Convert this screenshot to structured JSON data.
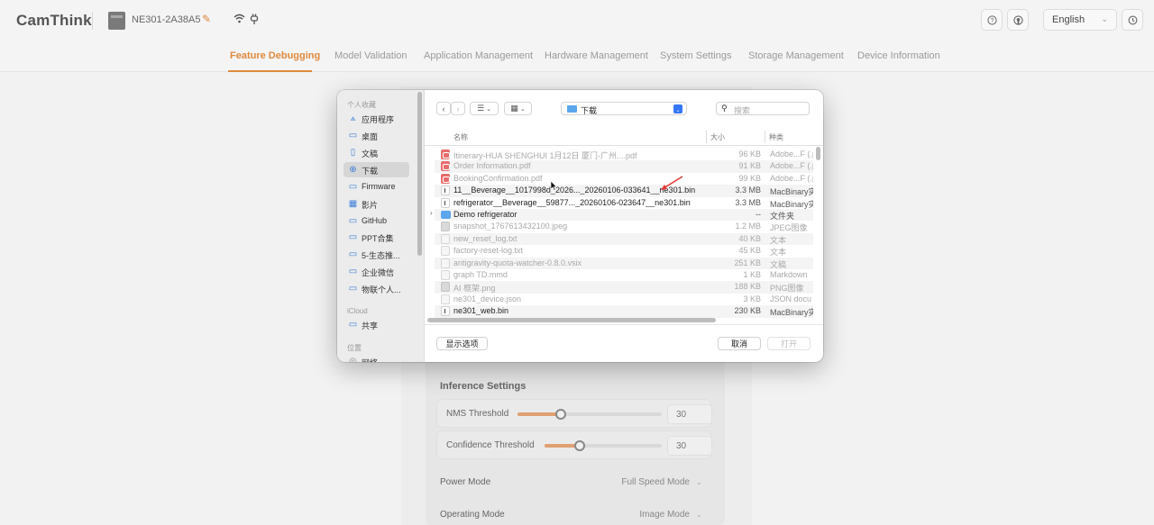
{
  "app": {
    "logo": "CamThink",
    "device_name": "NE301-2A38A5",
    "language": "English"
  },
  "nav": {
    "tabs": [
      {
        "label": "Feature Debugging"
      },
      {
        "label": "Model Validation"
      },
      {
        "label": "Application Management"
      },
      {
        "label": "Hardware Management"
      },
      {
        "label": "System Settings"
      },
      {
        "label": "Storage Management"
      },
      {
        "label": "Device Information"
      }
    ],
    "active_tab": "Feature Debugging"
  },
  "settings": {
    "inference_title": "Inference Settings",
    "nms": {
      "label": "NMS Threshold",
      "value": "30",
      "level": 0.3
    },
    "confidence": {
      "label": "Confidence Threshold",
      "value": "30",
      "level": 0.3
    },
    "power_mode": {
      "label": "Power Mode",
      "value": "Full Speed Mode"
    },
    "operating_mode": {
      "label": "Operating Mode",
      "value": "Image Mode"
    }
  },
  "dialog": {
    "location": "下载",
    "search_placeholder": "搜索",
    "columns": {
      "name": "名称",
      "size": "大小",
      "kind": "种类"
    },
    "sidebar": {
      "favorites_title": "个人收藏",
      "favorites": [
        {
          "label": "应用程序",
          "icon": "apps-icon"
        },
        {
          "label": "桌面",
          "icon": "desktop-icon"
        },
        {
          "label": "文稿",
          "icon": "document-icon"
        },
        {
          "label": "下载",
          "icon": "download-icon",
          "selected": true
        },
        {
          "label": "Firmware",
          "icon": "folder-icon"
        },
        {
          "label": "影片",
          "icon": "movie-icon"
        },
        {
          "label": "GitHub",
          "icon": "folder-icon"
        },
        {
          "label": "PPT合集",
          "icon": "folder-icon"
        },
        {
          "label": "5-生态推...",
          "icon": "folder-icon"
        },
        {
          "label": "企业微信",
          "icon": "folder-icon"
        },
        {
          "label": "物联个人...",
          "icon": "folder-icon"
        }
      ],
      "icloud_title": "iCloud",
      "icloud": [
        {
          "label": "共享",
          "icon": "shared-folder-icon"
        }
      ],
      "locations_title": "位置",
      "locations": [
        {
          "label": "网络",
          "icon": "network-icon"
        }
      ]
    },
    "files": [
      {
        "name": "Itinerary-HUA SHENGHUI 1月12日 厦门-广州....pdf",
        "size": "96 KB",
        "kind": "Adobe...F (.p",
        "type": "pdf",
        "enabled": false
      },
      {
        "name": "Order Information.pdf",
        "size": "91 KB",
        "kind": "Adobe...F (.p",
        "type": "pdf",
        "enabled": false
      },
      {
        "name": "BookingConfirmation.pdf",
        "size": "99 KB",
        "kind": "Adobe...F (.p",
        "type": "pdf",
        "enabled": false
      },
      {
        "name": "11__Beverage__1017998d_2026..._20260106-033641__ne301.bin",
        "size": "3.3 MB",
        "kind": "MacBinary实",
        "type": "bin",
        "enabled": true
      },
      {
        "name": "refrigerator__Beverage__59877..._20260106-023647__ne301.bin",
        "size": "3.3 MB",
        "kind": "MacBinary实",
        "type": "bin",
        "enabled": true
      },
      {
        "name": "Demo refrigerator",
        "size": "--",
        "kind": "文件夹",
        "type": "folder",
        "enabled": true
      },
      {
        "name": "snapshot_1767613432100.jpeg",
        "size": "1.2 MB",
        "kind": "JPEG图像",
        "type": "img",
        "enabled": false
      },
      {
        "name": "new_reset_log.txt",
        "size": "40 KB",
        "kind": "文本",
        "type": "doc",
        "enabled": false
      },
      {
        "name": "factory-reset-log.txt",
        "size": "45 KB",
        "kind": "文本",
        "type": "doc",
        "enabled": false
      },
      {
        "name": "antigravity-quota-watcher-0.8.0.vsix",
        "size": "251 KB",
        "kind": "文稿",
        "type": "doc",
        "enabled": false
      },
      {
        "name": "graph TD.mmd",
        "size": "1 KB",
        "kind": "Markdown",
        "type": "doc",
        "enabled": false
      },
      {
        "name": "AI 框架.png",
        "size": "188 KB",
        "kind": "PNG图像",
        "type": "img",
        "enabled": false
      },
      {
        "name": "ne301_device.json",
        "size": "3 KB",
        "kind": "JSON docu",
        "type": "doc",
        "enabled": false
      },
      {
        "name": "ne301_web.bin",
        "size": "230 KB",
        "kind": "MacBinary实",
        "type": "bin",
        "enabled": true
      }
    ],
    "buttons": {
      "options": "显示选项",
      "cancel": "取消",
      "open": "打开"
    }
  }
}
